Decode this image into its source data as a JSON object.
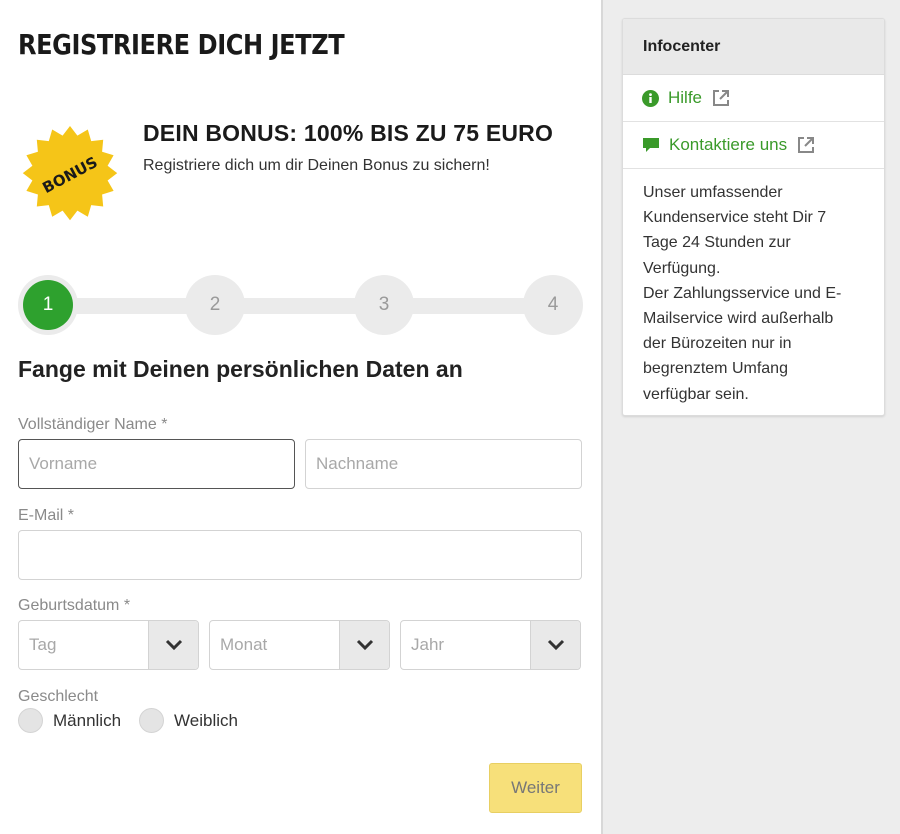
{
  "page": {
    "title": "REGISTRIERE DICH JETZT"
  },
  "bonus": {
    "badge_text": "BONUS",
    "title": "DEIN BONUS: 100% BIS ZU 75 EURO",
    "subtitle": "Registriere dich um dir Deinen Bonus zu sichern!",
    "badge_color": "#f5c518"
  },
  "stepper": {
    "steps": [
      "1",
      "2",
      "3",
      "4"
    ],
    "active_step": 1,
    "active_color": "#2ea12e"
  },
  "form": {
    "section_title": "Fange mit Deinen persönlichen Daten an",
    "name_label": "Vollständiger Name *",
    "first_name_placeholder": "Vorname",
    "last_name_placeholder": "Nachname",
    "email_label": "E-Mail *",
    "email_value": "",
    "birthdate_label": "Geburtsdatum *",
    "day_placeholder": "Tag",
    "month_placeholder": "Monat",
    "year_placeholder": "Jahr",
    "gender_label": "Geschlecht",
    "gender_options": [
      "Männlich",
      "Weiblich"
    ],
    "next_button": "Weiter",
    "next_button_color": "#f7e07a"
  },
  "infocenter": {
    "title": "Infocenter",
    "links": [
      {
        "label": "Hilfe",
        "icon": "info-circle-icon"
      },
      {
        "label": "Kontaktiere uns",
        "icon": "chat-bubble-icon"
      }
    ],
    "link_color": "#3a9a2a",
    "text_lines": [
      "Unser umfassender",
      "Kundenservice steht Dir 7",
      "Tage 24 Stunden zur",
      "Verfügung.",
      "Der Zahlungsservice und E-",
      "Mailservice wird außerhalb",
      "der Bürozeiten nur in",
      "begrenztem Umfang",
      "verfügbar sein."
    ]
  }
}
